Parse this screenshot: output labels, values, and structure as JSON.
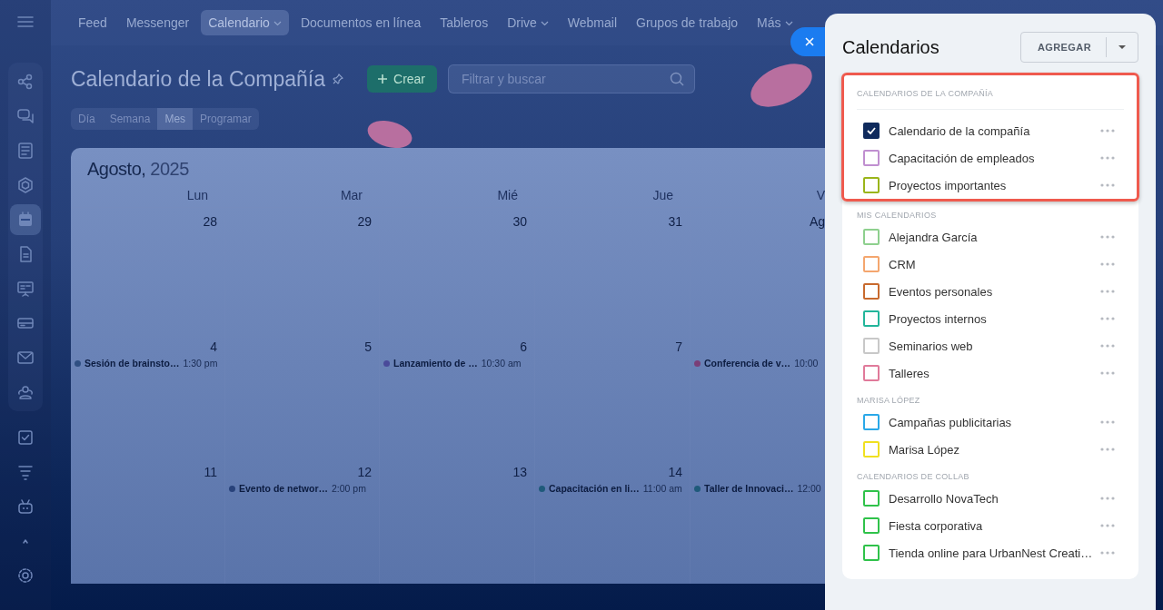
{
  "top_nav": [
    {
      "label": "Feed",
      "selected": false,
      "dropdown": false
    },
    {
      "label": "Messenger",
      "selected": false,
      "dropdown": false
    },
    {
      "label": "Calendario",
      "selected": true,
      "dropdown": true
    },
    {
      "label": "Documentos en línea",
      "selected": false,
      "dropdown": false
    },
    {
      "label": "Tableros",
      "selected": false,
      "dropdown": false
    },
    {
      "label": "Drive",
      "selected": false,
      "dropdown": true
    },
    {
      "label": "Webmail",
      "selected": false,
      "dropdown": false
    },
    {
      "label": "Grupos de trabajo",
      "selected": false,
      "dropdown": false
    },
    {
      "label": "Más",
      "selected": false,
      "dropdown": true
    }
  ],
  "left_nav": [
    {
      "kind": "flow",
      "selected": false
    },
    {
      "kind": "chat",
      "selected": false
    },
    {
      "kind": "news",
      "selected": false
    },
    {
      "kind": "hexagon",
      "selected": false
    },
    {
      "kind": "calendar",
      "selected": true
    },
    {
      "kind": "document",
      "selected": false
    },
    {
      "kind": "board",
      "selected": false
    },
    {
      "kind": "drive",
      "selected": false
    },
    {
      "kind": "mail",
      "selected": false
    },
    {
      "kind": "people",
      "selected": false
    },
    {
      "kind": "task",
      "selected": false
    },
    {
      "kind": "funnel",
      "selected": false
    },
    {
      "kind": "robot",
      "selected": false
    },
    {
      "kind": "caret",
      "selected": false
    },
    {
      "kind": "gear",
      "selected": false
    }
  ],
  "page": {
    "title": "Calendario de la Compañía",
    "create_button": "Crear",
    "search": {
      "placeholder": "Filtrar y buscar"
    },
    "view_tabs": [
      {
        "label": "Día",
        "selected": false
      },
      {
        "label": "Semana",
        "selected": false
      },
      {
        "label": "Mes",
        "selected": true
      },
      {
        "label": "Programar",
        "selected": false
      }
    ]
  },
  "calendar": {
    "month": "Agosto,",
    "year": "2025",
    "weekdays": [
      "Lun",
      "Mar",
      "Mié",
      "Jue",
      "V"
    ],
    "weeks": [
      [
        {
          "day": "28"
        },
        {
          "day": "29"
        },
        {
          "day": "30"
        },
        {
          "day": "31"
        },
        {
          "day": "Ag"
        }
      ],
      [
        {
          "day": "4",
          "events": [
            {
              "title": "Sesión de brainsto…",
              "time": "1:30 pm",
              "color": "#2f4f82"
            }
          ]
        },
        {
          "day": "5"
        },
        {
          "day": "6",
          "events": [
            {
              "title": "Lanzamiento de …",
              "time": "10:30 am",
              "color": "#4a4a9a"
            }
          ]
        },
        {
          "day": "7"
        },
        {
          "events": [
            {
              "title": "Conferencia de v…",
              "time": "10:00",
              "color": "#7a3f78"
            }
          ]
        }
      ],
      [
        {
          "day": "11"
        },
        {
          "day": "12",
          "events": [
            {
              "title": "Evento de networ…",
              "time": "2:00 pm",
              "color": "#28427a"
            }
          ]
        },
        {
          "day": "13"
        },
        {
          "day": "14",
          "events": [
            {
              "title": "Capacitación en li…",
              "time": "11:00 am",
              "color": "#1f5a7a"
            }
          ]
        },
        {
          "events": [
            {
              "title": "Taller de Innovaci…",
              "time": "12:00",
              "color": "#1f5a7a"
            }
          ]
        }
      ]
    ]
  },
  "panel": {
    "title": "Calendarios",
    "add_button": "AGREGAR",
    "groups": [
      {
        "title": "CALENDARIOS DE LA COMPAÑÍA",
        "highlighted": true,
        "items": [
          {
            "label": "Calendario de la compañía",
            "checked": true,
            "color": "#0f2a5c"
          },
          {
            "label": "Capacitación de empleados",
            "checked": false,
            "color": "#c08fd0"
          },
          {
            "label": "Proyectos importantes",
            "checked": false,
            "color": "#9ab51a"
          }
        ]
      },
      {
        "title": "MIS CALENDARIOS",
        "highlighted": false,
        "items": [
          {
            "label": "Alejandra García",
            "checked": false,
            "color": "#8ed08e"
          },
          {
            "label": "CRM",
            "checked": false,
            "color": "#f4a66e"
          },
          {
            "label": "Eventos personales",
            "checked": false,
            "color": "#c86a2e"
          },
          {
            "label": "Proyectos internos",
            "checked": false,
            "color": "#22b59a"
          },
          {
            "label": "Seminarios web",
            "checked": false,
            "color": "#c8c8c8"
          },
          {
            "label": "Talleres",
            "checked": false,
            "color": "#e07a9a"
          }
        ]
      },
      {
        "title": "MARISA LÓPEZ",
        "highlighted": false,
        "items": [
          {
            "label": "Campañas publicitarias",
            "checked": false,
            "color": "#2aa8e8"
          },
          {
            "label": "Marisa López",
            "checked": false,
            "color": "#f0e020"
          }
        ]
      },
      {
        "title": "CALENDARIOS DE COLLAB",
        "highlighted": false,
        "items": [
          {
            "label": "Desarrollo NovaTech",
            "checked": false,
            "color": "#2fc24a"
          },
          {
            "label": "Fiesta corporativa",
            "checked": false,
            "color": "#2fc24a"
          },
          {
            "label": "Tienda online para UrbanNest Creati…",
            "checked": false,
            "color": "#2fc24a"
          }
        ]
      }
    ]
  }
}
